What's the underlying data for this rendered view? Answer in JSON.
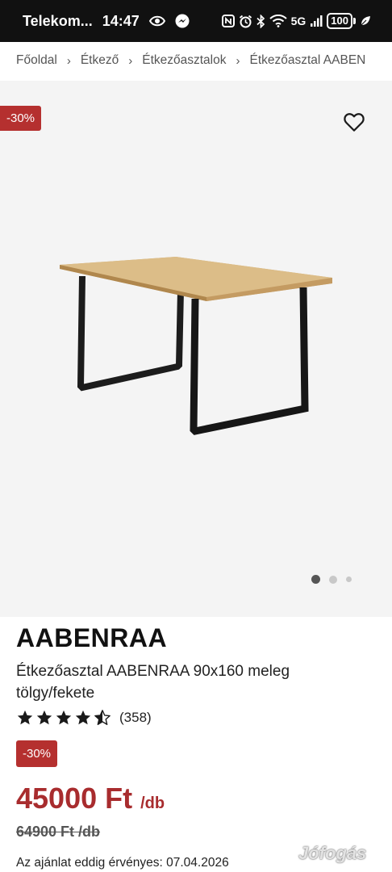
{
  "status_bar": {
    "carrier": "Telekom...",
    "time": "14:47",
    "network": "5G",
    "battery": "100"
  },
  "breadcrumb": [
    "Főoldal",
    "Étkező",
    "Étkezőasztalok",
    "Étkezőasztal AABEN"
  ],
  "gallery": {
    "discount_badge": "-30%",
    "slides": 3,
    "active_slide": 1,
    "image_icon": "dining-table-product-photo"
  },
  "product": {
    "brand": "AABENRAA",
    "title": "Étkezőasztal AABENRAA 90x160 meleg tölgy/fekete",
    "rating_stars": 4.5,
    "review_count": "(358)",
    "discount_badge": "-30%",
    "price": "45000 Ft",
    "price_unit": "/db",
    "old_price": "64900 Ft /db",
    "validity": "Az ajánlat eddig érvényes: 07.04.2026"
  },
  "watermark": "Jófogás",
  "colors": {
    "accent": "#b5302f",
    "price": "#a82c2e",
    "gallery_bg": "#f4f4f4"
  }
}
